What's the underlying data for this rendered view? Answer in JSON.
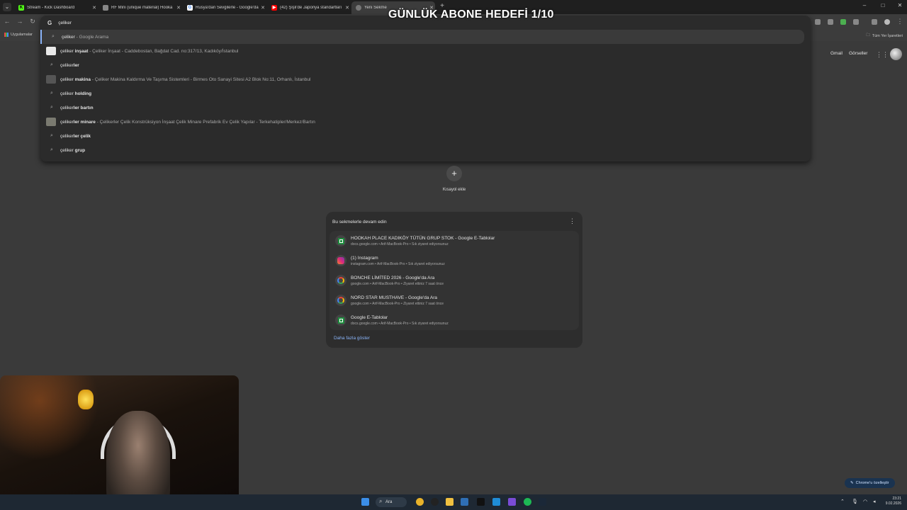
{
  "overlay_title": "GÜNLÜK ABONE HEDEFİ 1/10",
  "tabs": [
    {
      "label": "Stream - Kick Dashboard",
      "favicon_color": "#53fc18",
      "favicon_text": "K"
    },
    {
      "label": "RF Mini (unique material) Hooka",
      "favicon_color": "#888888",
      "favicon_text": ""
    },
    {
      "label": "Rusya'dan Sevgilerle - Google'da",
      "favicon_color": "#4285f4",
      "favicon_text": "G"
    },
    {
      "label": "(42) Şişli'de Japonya standartları",
      "favicon_color": "#ff0000",
      "favicon_text": "▶"
    },
    {
      "label": "Yeni Sekme",
      "favicon_color": "#777777",
      "favicon_text": ""
    }
  ],
  "window_controls": {
    "minimize": "–",
    "maximize": "□",
    "close": "✕"
  },
  "omnibox": {
    "typed": "çeliker",
    "suggestions": [
      {
        "prefix": "çeliker",
        "bold": "",
        "sub": " - Google Arama",
        "icon": "search"
      },
      {
        "prefix": "çeliker",
        "bold": " inşaat",
        "sub": " - Çeliker İnşaat - Caddebostan, Bağdat Cad. no:317/13, Kadıköy/İstanbul",
        "icon": "thumb"
      },
      {
        "prefix": "çeliker",
        "bold": "ler",
        "sub": "",
        "icon": "search"
      },
      {
        "prefix": "çeliker",
        "bold": " makina",
        "sub": " - Çeliker Makina Kaldırma Ve Taşıma Sistemleri - Birmes Oto Sanayi Sitesi A2 Blok No:11, Orhanlı, İstanbul",
        "icon": "thumb"
      },
      {
        "prefix": "çeliker",
        "bold": " holding",
        "sub": "",
        "icon": "search"
      },
      {
        "prefix": "çeliker",
        "bold": "ler bartın",
        "sub": "",
        "icon": "search"
      },
      {
        "prefix": "çeliker",
        "bold": "ler minare",
        "sub": " - Çelikerler Çelik Konstrüksiyon İnşaat Çelik Minare Prefabrik Ev Çelik Yapılar - Terkehatipler/Merkez/Bartın",
        "icon": "thumb"
      },
      {
        "prefix": "çeliker",
        "bold": "ler çelik",
        "sub": "",
        "icon": "search"
      },
      {
        "prefix": "çeliker",
        "bold": " grup",
        "sub": "",
        "icon": "search"
      }
    ]
  },
  "bookmarks": {
    "apps": "Uygulamalar",
    "all": "Tüm Yer İşaretleri"
  },
  "google_links": {
    "gmail": "Gmail",
    "images": "Görseller"
  },
  "shortcut": {
    "add_icon": "+",
    "label": "Kısayol ekle"
  },
  "continue_card": {
    "title": "Bu sekmelerle devam edin",
    "menu": "⋮",
    "items": [
      {
        "title": "HOOKAH PLACE KADIKÖY TÜTÜN GRUP STOK - Google E-Tablolar",
        "sub": "docs.google.com • Arif-MacBook-Pro • Sık ziyaret ediyorsunuz",
        "icon": "sheets-icon"
      },
      {
        "title": "(1) Instagram",
        "sub": "instagram.com • Arif-MacBook-Pro • Sık ziyaret ediyorsunuz",
        "icon": "instagram-icon"
      },
      {
        "title": "BONCHE LİMİTED 2026 - Google'da Ara",
        "sub": "google.com • Arif-MacBook-Pro • Ziyaret ettiniz 7 saat önce",
        "icon": "google-icon"
      },
      {
        "title": "NORD STAR MUSTHAVE - Google'da Ara",
        "sub": "google.com • Arif-MacBook-Pro • Ziyaret ettiniz 7 saat önce",
        "icon": "google-icon"
      },
      {
        "title": "Google E-Tablolar",
        "sub": "docs.google.com • Arif-MacBook-Pro • Sık ziyaret ediyorsunuz",
        "icon": "sheets-icon"
      }
    ],
    "more": "Daha fazla göster"
  },
  "customize": "Chrome'u özelleştir",
  "taskbar": {
    "search": "Ara",
    "time": "23:21",
    "date": "9.02.2026"
  }
}
